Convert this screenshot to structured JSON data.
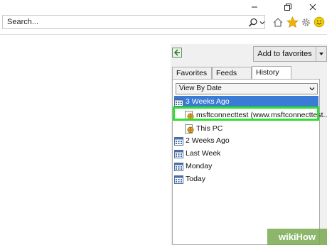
{
  "search": {
    "placeholder": "Search..."
  },
  "favorites_panel": {
    "add_button_label": "Add to favorites",
    "tabs": [
      {
        "label": "Favorites"
      },
      {
        "label": "Feeds"
      },
      {
        "label": "History"
      }
    ],
    "active_tab": "History",
    "view_select": "View By Date",
    "history": [
      {
        "label": "3 Weeks Ago",
        "selected": true
      },
      {
        "label": "msftconnecttest (www.msftconnecttest...",
        "highlighted": true
      },
      {
        "label": "This PC"
      },
      {
        "label": "2 Weeks Ago"
      },
      {
        "label": "Last Week"
      },
      {
        "label": "Monday"
      },
      {
        "label": "Today"
      }
    ]
  },
  "icons": [
    "minimize-icon",
    "restore-icon",
    "close-icon",
    "search-icon",
    "home-icon",
    "star-icon",
    "gear-icon",
    "smiley-icon",
    "pin-icon",
    "calendar-icon",
    "globe-page-icon"
  ],
  "colors": {
    "selection": "#3a7bd5",
    "highlight": "#2fe02f",
    "star": "#f2b200",
    "smiley": "#f5d000"
  },
  "watermark": "wikiHow"
}
